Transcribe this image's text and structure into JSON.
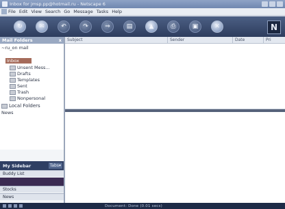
{
  "window": {
    "title": "Inbox for jmsp.pp@hotmail.ru - Netscape 6"
  },
  "menu": {
    "items": [
      "File",
      "Edit",
      "View",
      "Search",
      "Go",
      "Message",
      "Tasks",
      "Help"
    ]
  },
  "toolbar": {
    "buttons": [
      {
        "icon": "get-msg-icon",
        "glyph": "↻",
        "state": "lit"
      },
      {
        "icon": "new-msg-icon",
        "glyph": "✉",
        "state": "lit"
      },
      {
        "icon": "reply-icon",
        "glyph": "↶",
        "state": "dim"
      },
      {
        "icon": "reply-all-icon",
        "glyph": "↷",
        "state": "dim"
      },
      {
        "icon": "forward-icon",
        "glyph": "⇒",
        "state": "dim"
      },
      {
        "icon": "file-icon",
        "glyph": "▤",
        "state": "dim"
      },
      {
        "icon": "next-icon",
        "glyph": "▲",
        "state": "lit"
      },
      {
        "icon": "print-icon",
        "glyph": "⎙",
        "state": "dim"
      },
      {
        "icon": "delete-icon",
        "glyph": "▣",
        "state": "dim"
      },
      {
        "icon": "stop-icon",
        "glyph": "✕",
        "state": "lit"
      }
    ],
    "logo": "N"
  },
  "folders": {
    "header": "Mail Folders",
    "close": "x",
    "account": "~ru_on mail",
    "selected": "Inbox",
    "items": [
      "Unsent Mess...",
      "Drafts",
      "Templates",
      "Sent",
      "Trash",
      "Nonpersonal"
    ],
    "local": "Local Folders",
    "news": "News"
  },
  "sidebar": {
    "title": "My Sidebar",
    "tabs_label": "Tabs▾",
    "items": [
      "Buddy List",
      "Stocks",
      "News"
    ]
  },
  "thread_pane": {
    "columns": [
      "Subject",
      "Sender",
      "Date",
      "Pri"
    ]
  },
  "status": {
    "text": "Document: Done (0.01 secs)"
  }
}
